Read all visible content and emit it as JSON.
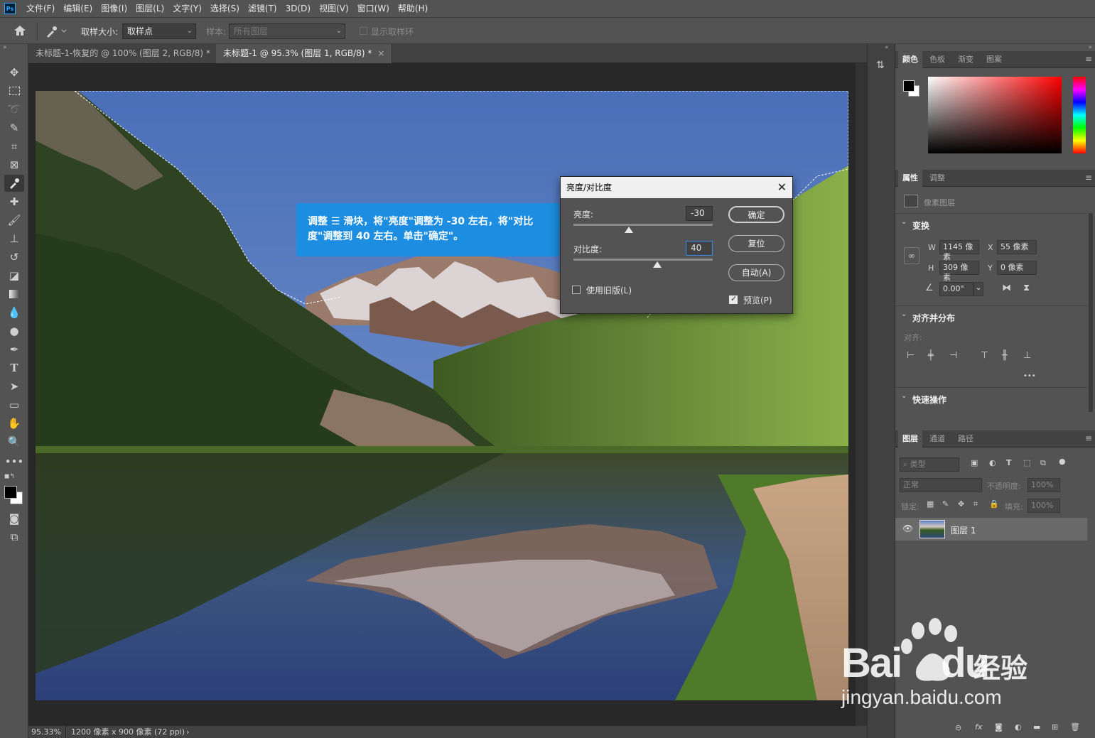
{
  "menubar": {
    "logo": "Ps",
    "items": [
      "文件(F)",
      "编辑(E)",
      "图像(I)",
      "图层(L)",
      "文字(Y)",
      "选择(S)",
      "滤镜(T)",
      "3D(D)",
      "视图(V)",
      "窗口(W)",
      "帮助(H)"
    ]
  },
  "options": {
    "home_icon": "home-icon",
    "tool_icon": "eyedropper-icon",
    "sample_size_label": "取样大小:",
    "sample_size_value": "取样点",
    "sample_label": "样本:",
    "sample_value": "所有图层",
    "show_ring_label": "显示取样环"
  },
  "tabs": [
    {
      "label": "未标题-1-恢复的 @ 100% (图层 2, RGB/8) *",
      "close": "×"
    },
    {
      "label": "未标题-1 @ 95.3% (图层 1, RGB/8) *",
      "close": "×"
    }
  ],
  "status": {
    "zoom": "95.33%",
    "doc_info": "1200 像素 x 900 像素 (72 ppi)",
    "arrow": "›"
  },
  "dialog": {
    "title": "亮度/对比度",
    "close": "✕",
    "brightness_label": "亮度:",
    "brightness_value": "-30",
    "brightness_level": -30,
    "contrast_label": "对比度:",
    "contrast_value": "40",
    "contrast_level": 40,
    "ok": "确定",
    "reset": "复位",
    "auto": "自动(A)",
    "legacy_label": "使用旧版(L)",
    "legacy_checked": false,
    "preview_label": "预览(P)",
    "preview_checked": true
  },
  "callout": {
    "text": "调整 ☰ 滑块，将\"亮度\"调整为 -30 左右，将\"对比度\"调整到 40 左右。单击\"确定\"。"
  },
  "color_panel": {
    "tabs": [
      "颜色",
      "色板",
      "渐变",
      "图案"
    ],
    "active_tab": "颜色",
    "foreground": "#000000",
    "background": "#ffffff",
    "hue_color": "#ff0000"
  },
  "properties_panel": {
    "tabs": [
      "属性",
      "调整"
    ],
    "active_tab": "属性",
    "layer_type": "像素图层",
    "transform_title": "变换",
    "w_label": "W",
    "w_value": "1145 像素",
    "x_label": "X",
    "x_value": "55 像素",
    "h_label": "H",
    "h_value": "309 像素",
    "y_label": "Y",
    "y_value": "0 像素",
    "angle_value": "0.00°",
    "align_title": "对齐并分布",
    "align_label": "对齐:",
    "more": "•••",
    "quick_title": "快速操作"
  },
  "layers_panel": {
    "tabs": [
      "图层",
      "通道",
      "路径"
    ],
    "active_tab": "图层",
    "filter_placeholder": "类型",
    "blend_mode": "正常",
    "opacity_label": "不透明度:",
    "opacity_value": "100%",
    "lock_label": "锁定:",
    "fill_label": "填充:",
    "fill_value": "100%",
    "layers": [
      {
        "name": "图层 1",
        "visible": true
      }
    ]
  },
  "watermark": {
    "brand": "Bai",
    "brand2": "du",
    "cn": "经验",
    "url": "jingyan.baidu.com"
  }
}
